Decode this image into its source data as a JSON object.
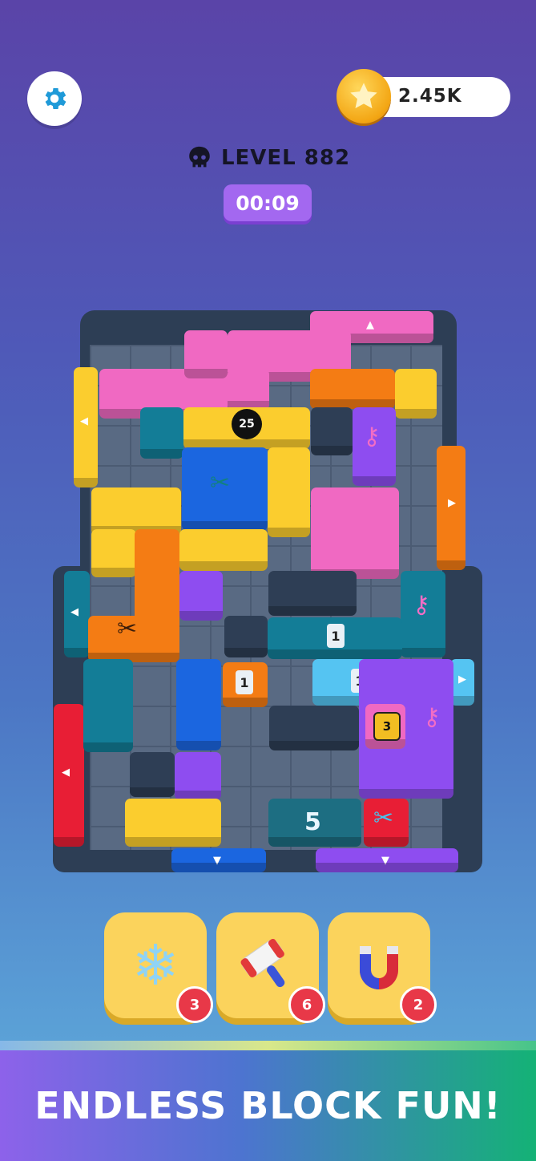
{
  "header": {
    "coins": "2.45K",
    "level_label": "LEVEL 882",
    "timer": "00:09",
    "settings_icon": "gear-icon",
    "coin_icon": "star-coin-icon",
    "level_icon": "skull-icon"
  },
  "board": {
    "bomb_moves": "25",
    "lock_count": "3",
    "ice_count": "5",
    "tag_1": "1",
    "tag_2": "1",
    "tag_3": "1"
  },
  "boosters": [
    {
      "name": "freeze",
      "icon": "snowflake-icon",
      "count": "3"
    },
    {
      "name": "hammer",
      "icon": "hammer-icon",
      "count": "6"
    },
    {
      "name": "magnet",
      "icon": "magnet-icon",
      "count": "2"
    }
  ],
  "banner": {
    "text": "ENDLESS BLOCK FUN!"
  }
}
